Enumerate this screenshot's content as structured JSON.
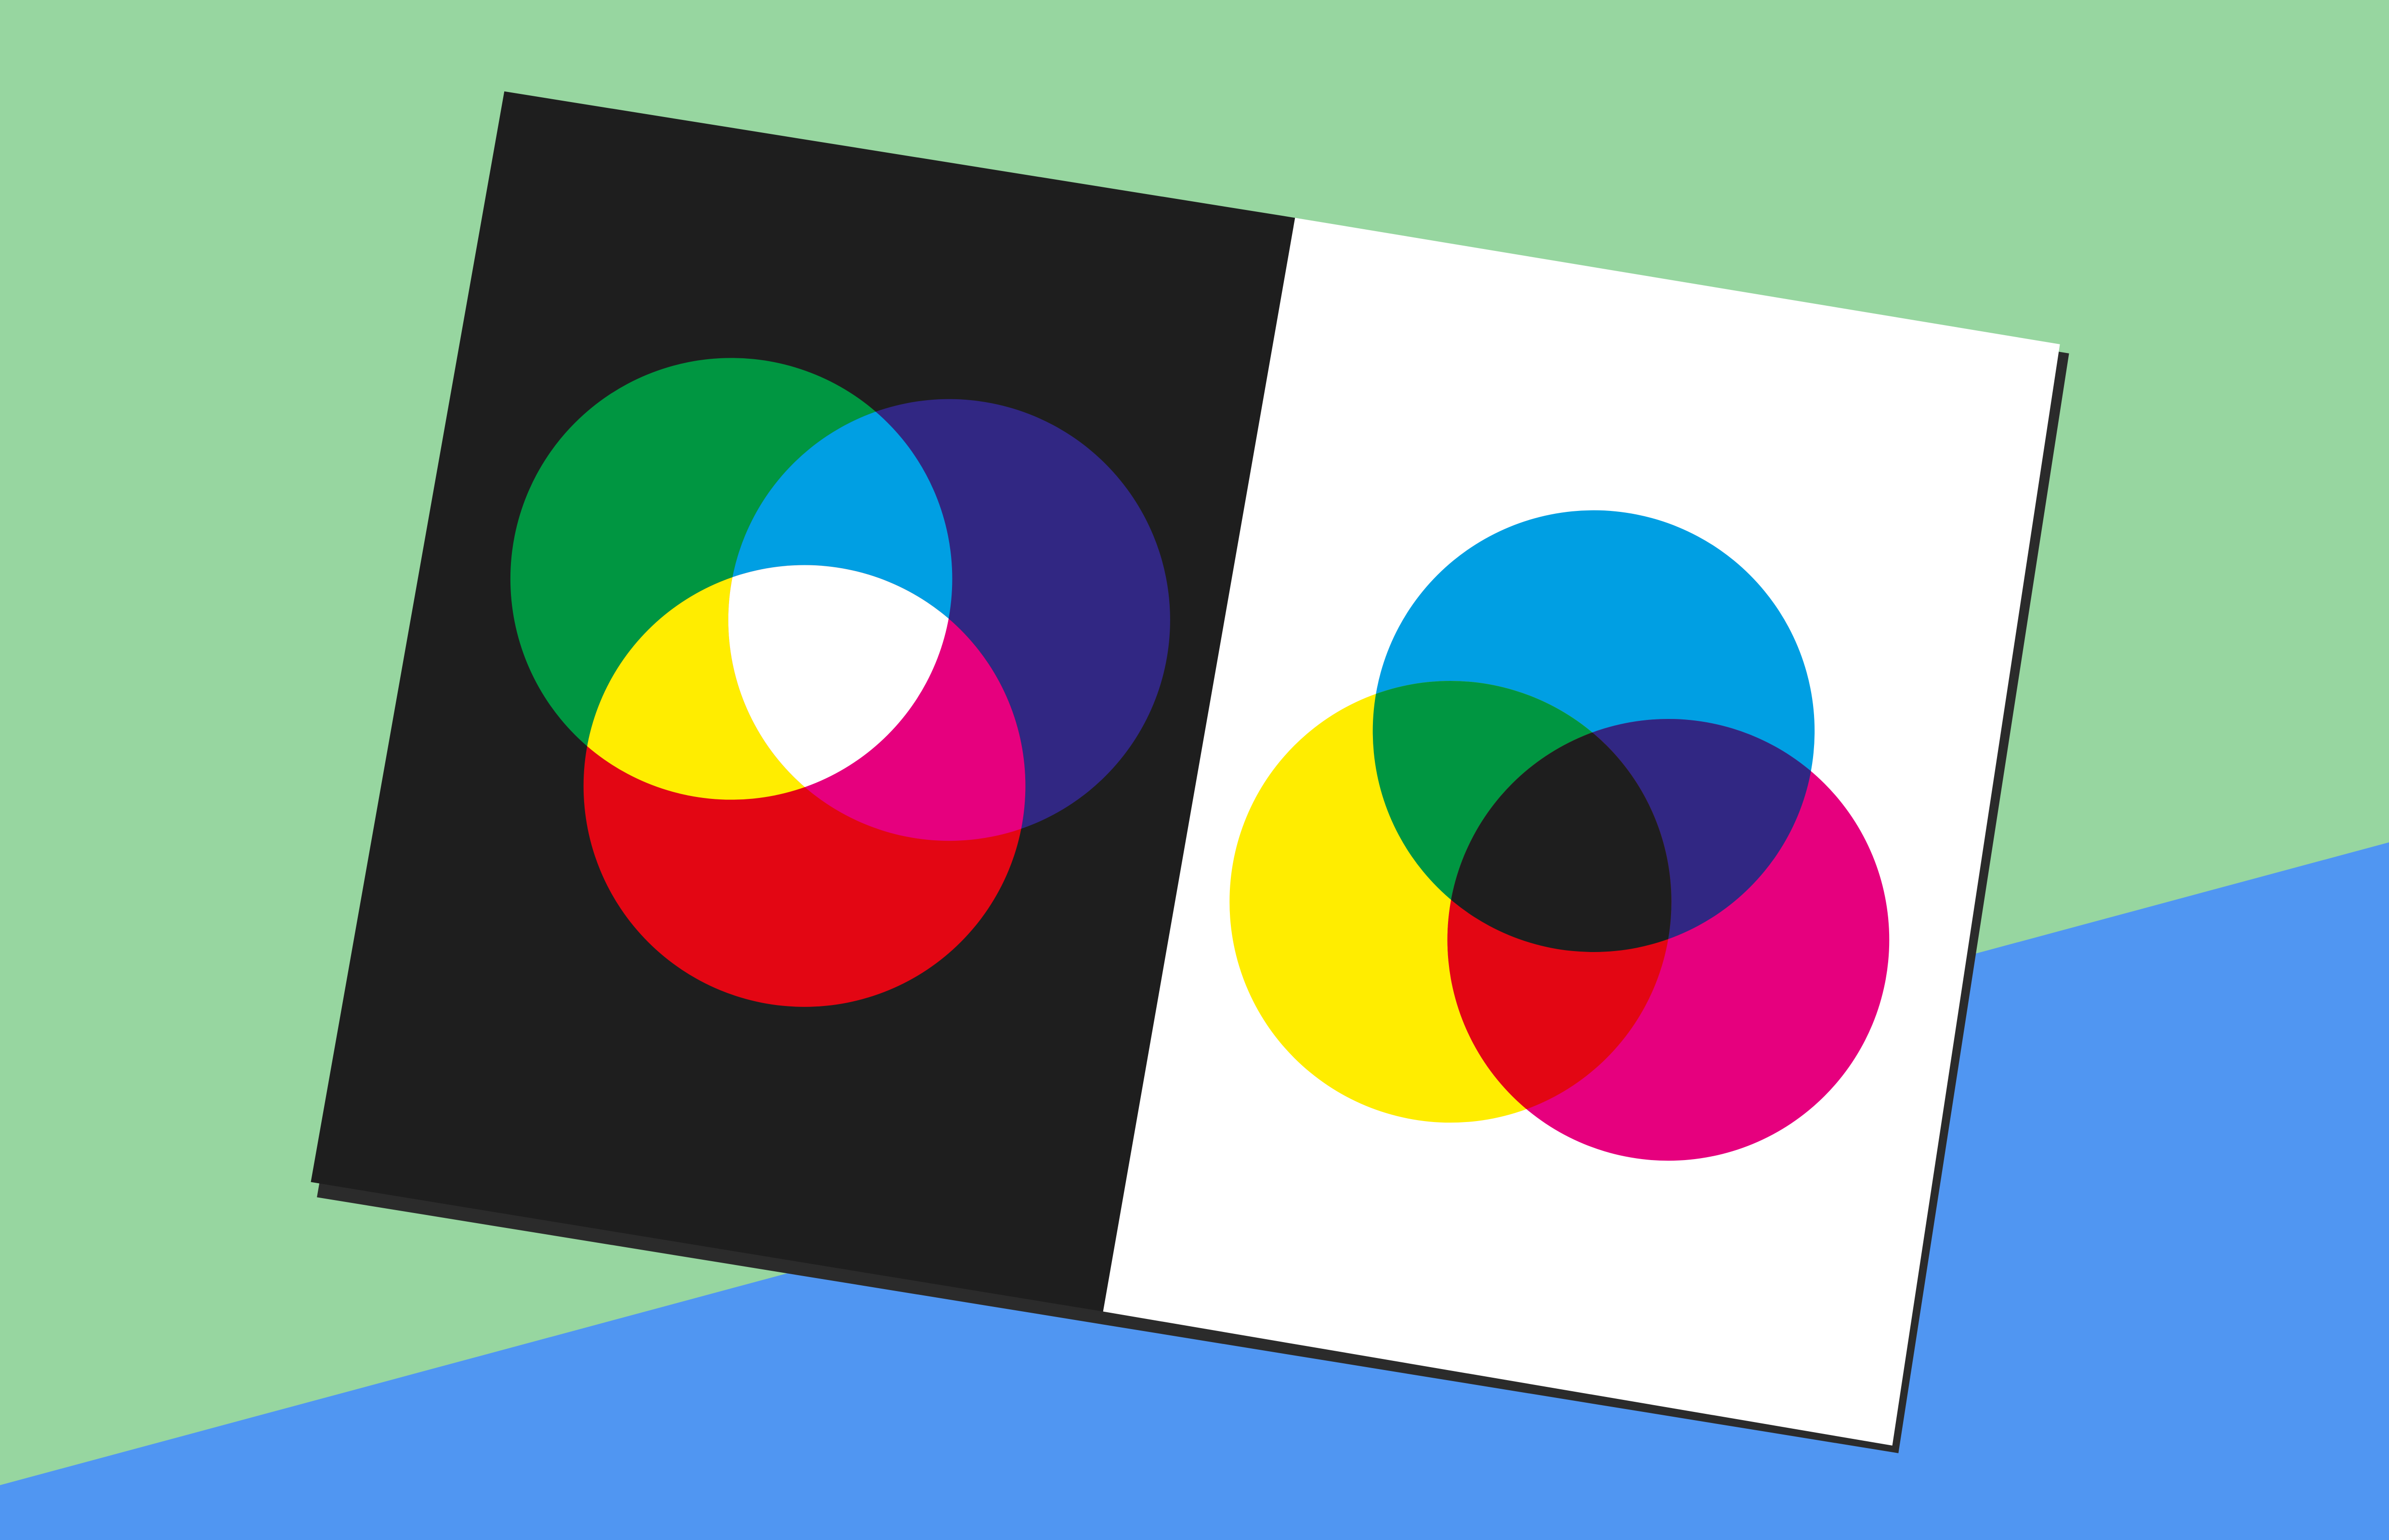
{
  "background": {
    "upper_color": "#97d6a0",
    "lower_color": "#5096f2"
  },
  "card": {
    "shadow_color": "#2b2b2b",
    "additive_panel": {
      "color": "#1e1e1e",
      "model": "additive",
      "circles": [
        {
          "name": "green",
          "color": "#009641"
        },
        {
          "name": "blue",
          "color": "#312783"
        },
        {
          "name": "red",
          "color": "#e30613"
        }
      ],
      "overlaps": [
        {
          "between": [
            "green",
            "blue"
          ],
          "color": "#009fe3"
        },
        {
          "between": [
            "green",
            "red"
          ],
          "color": "#ffed00"
        },
        {
          "between": [
            "blue",
            "red"
          ],
          "color": "#e6007e"
        },
        {
          "between": [
            "green",
            "blue",
            "red"
          ],
          "color": "#ffffff"
        }
      ]
    },
    "subtractive_panel": {
      "color": "#ffffff",
      "model": "subtractive",
      "circles": [
        {
          "name": "cyan",
          "color": "#009fe3"
        },
        {
          "name": "yellow",
          "color": "#ffed00"
        },
        {
          "name": "magenta",
          "color": "#e6007e"
        }
      ],
      "overlaps": [
        {
          "between": [
            "cyan",
            "yellow"
          ],
          "color": "#009641"
        },
        {
          "between": [
            "cyan",
            "magenta"
          ],
          "color": "#312783"
        },
        {
          "between": [
            "yellow",
            "magenta"
          ],
          "color": "#e30613"
        },
        {
          "between": [
            "cyan",
            "yellow",
            "magenta"
          ],
          "color": "#1e1e1e"
        }
      ]
    }
  }
}
